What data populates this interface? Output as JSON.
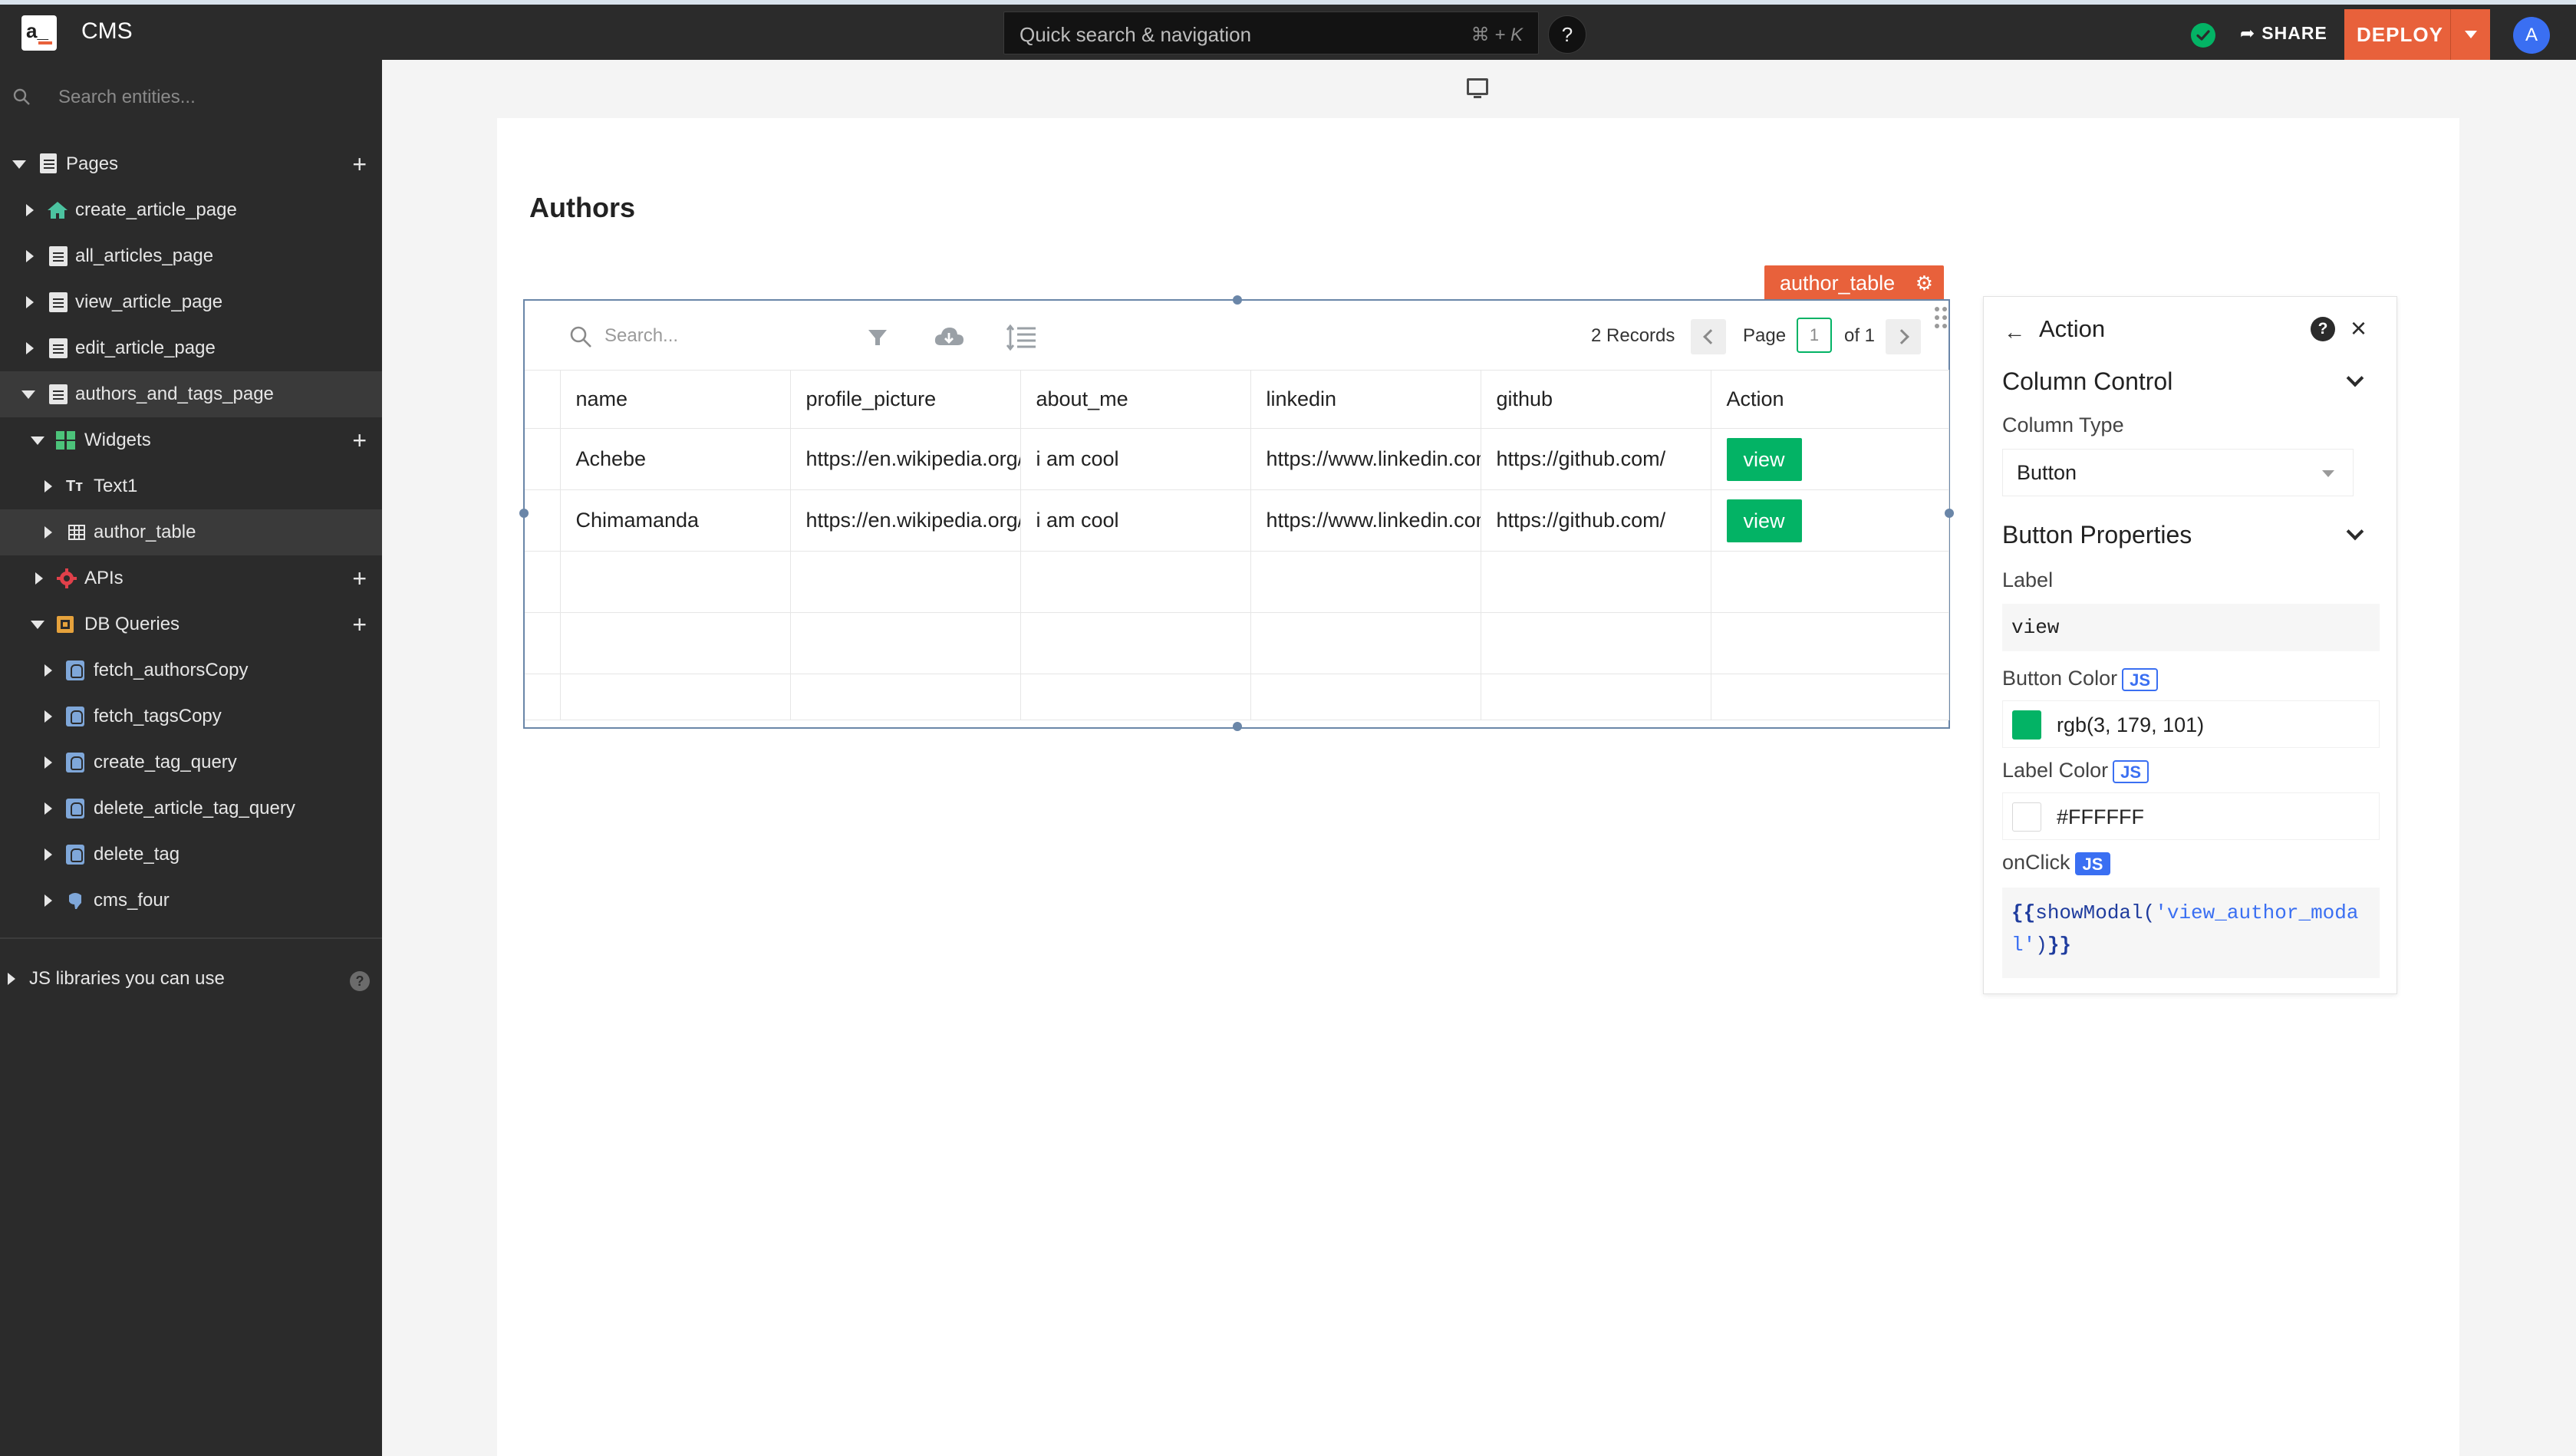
{
  "topbar": {
    "app_title": "CMS",
    "logo_text": "a_",
    "quick_search": "Quick search & navigation",
    "quick_search_shortcut": "⌘ + K",
    "help": "?",
    "share": "SHARE",
    "deploy": "DEPLOY",
    "avatar_initial": "A",
    "colors": {
      "bar": "#2b2b2b",
      "deploy": "#e8613b",
      "status": "#03b365",
      "avatar": "#3a6ff2"
    }
  },
  "sidebar": {
    "search_placeholder": "Search entities...",
    "pages_label": "Pages",
    "pages": [
      "create_article_page",
      "all_articles_page",
      "view_article_page",
      "edit_article_page",
      "authors_and_tags_page"
    ],
    "widgets_label": "Widgets",
    "widgets": [
      "Text1",
      "author_table"
    ],
    "apis_label": "APIs",
    "db_queries_label": "DB Queries",
    "db_queries": [
      "fetch_authorsCopy",
      "fetch_tagsCopy",
      "create_tag_query",
      "delete_article_tag_query",
      "delete_tag",
      "cms_four"
    ],
    "js_libraries": "JS libraries you can use",
    "text_widget_glyph": "Tт"
  },
  "canvas": {
    "page_heading": "Authors",
    "widget_name": "author_table",
    "table": {
      "search_placeholder": "Search...",
      "records": "2 Records",
      "page_label": "Page",
      "page_value": "1",
      "page_of": "of 1",
      "columns": [
        "name",
        "profile_picture",
        "about_me",
        "linkedin",
        "github",
        "Action"
      ],
      "rows": [
        [
          "Achebe",
          "https://en.wikipedia.org/",
          "i am cool",
          "https://www.linkedin.com/",
          "https://github.com/",
          "view"
        ],
        [
          "Chimamanda",
          "https://en.wikipedia.org/",
          "i am cool",
          "https://www.linkedin.com/",
          "https://github.com/",
          "view"
        ]
      ]
    }
  },
  "property_pane": {
    "title": "Action",
    "column_control": "Column Control",
    "column_type_label": "Column Type",
    "column_type_value": "Button",
    "button_properties": "Button Properties",
    "label_label": "Label",
    "label_value": "view",
    "button_color_label": "Button Color",
    "button_color_value": "rgb(3, 179, 101)",
    "button_color_swatch": "#03b365",
    "label_color_label": "Label Color",
    "label_color_value": "#FFFFFF",
    "onclick_label": "onClick",
    "js_badge": "JS",
    "onclick": {
      "open": "{{",
      "fn": "showModal(",
      "arg": "'view_author_modal'",
      "close_paren": ")",
      "close": "}}"
    }
  }
}
